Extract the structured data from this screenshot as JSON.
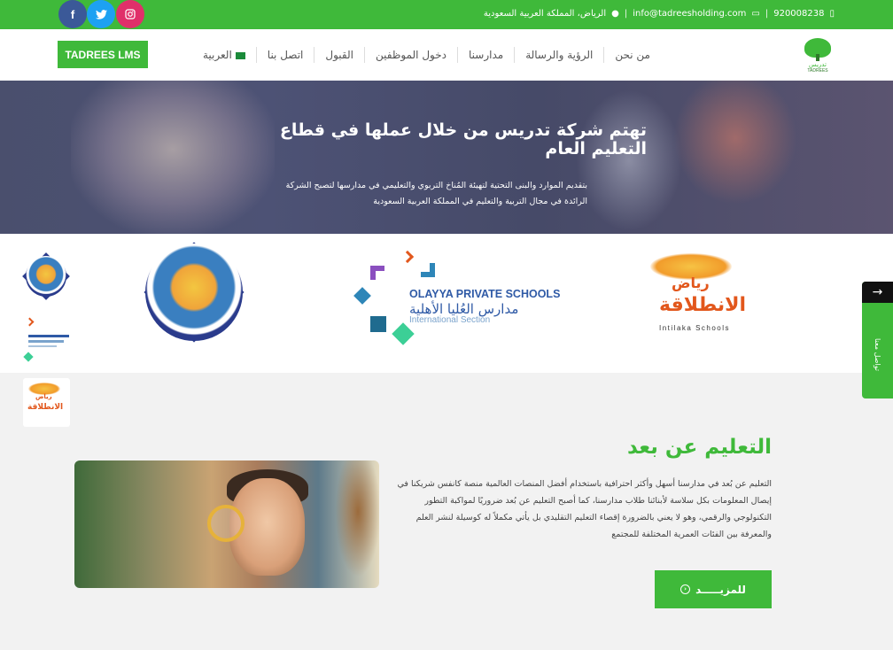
{
  "topbar": {
    "phone": "920008238",
    "email": "info@tadreesholding.com",
    "location": "الرياض، المملكة العربية السعودية",
    "social": [
      {
        "name": "facebook",
        "glyph": "f",
        "color": "#3b5998"
      },
      {
        "name": "twitter",
        "glyph": "t",
        "color": "#1da1f2"
      },
      {
        "name": "instagram",
        "glyph": "◎",
        "color": "#e0306a"
      }
    ]
  },
  "logo": {
    "ar": "تدريس",
    "en": "TADREES"
  },
  "nav": {
    "items": [
      "من نحن",
      "الرؤية والرسالة",
      "مدارسنا",
      "دخول الموظفين",
      "القبول",
      "اتصل بنا",
      "العربية"
    ],
    "lms_label": "TADREES LMS"
  },
  "hero": {
    "title": "تهتم شركة تدريس من خلال عملها في قطاع التعليم العام",
    "subtitle": "بتقديم الموارد والبنى التحتية لتهيئة المُناخ التربوي والتعليمي في مدارسها لتصبح الشركة الرائدة في مجال التربية والتعليم في المملكة العربية السعودية"
  },
  "schools": {
    "olayya_en": "OLAYYA PRIVATE SCHOOLS",
    "olayya_ar": "مدارس العُليا الأهلية",
    "olayya_section": "International Section",
    "intilaka_ar1": "رياض",
    "intilaka_ar2": "الانطلاقة",
    "intilaka_en": "Intilaka Schools"
  },
  "float_tab": {
    "arrow": "→",
    "label": "تواصل معنا"
  },
  "distance": {
    "title": "التعليم عن بعد",
    "text": "التعليم عن بُعد في مدارسنا أسهل وأكثر احترافية باستخدام أفضل المنصات العالمية منصة كانفس شريكنا في إيصال المعلومات بكل سلاسة لأبنائنا طلاب مدارسنا، كما أصبح التعليم عن بُعد ضروريًا لمواكبة التطور التكنولوجي والرقمي، وهو لا يعني بالضرورة إقصاء التعليم التقليدي بل يأتي مكملاً له كوسيلة لنشر العلم والمعرفة بين الفئات العمرية المختلفة للمجتمع",
    "more_label": "للمزيـــــد"
  },
  "colors": {
    "brand_green": "#3fb93a",
    "nav_text": "#555555",
    "olayya_blue": "#2f5aa6",
    "intilaka_orange": "#e2571c"
  }
}
